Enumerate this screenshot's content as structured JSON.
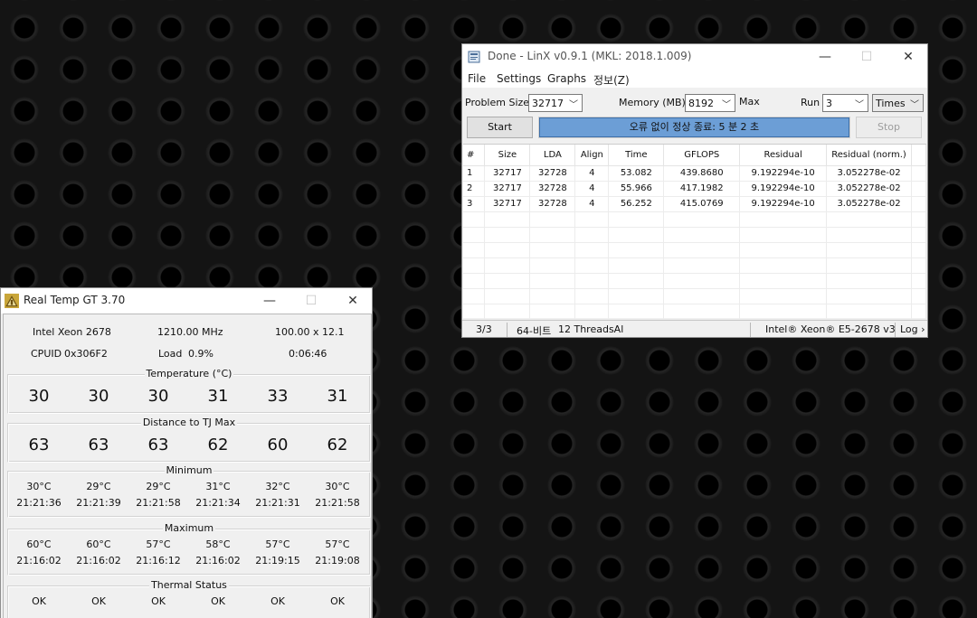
{
  "linx": {
    "title": "Done - LinX v0.9.1 (MKL: 2018.1.009)",
    "icon": "linx-app-icon",
    "window_controls": [
      "—",
      "☐",
      "✕"
    ],
    "menu": [
      "File",
      "Settings",
      "Graphs",
      "정보(Z)"
    ],
    "problem_size_label": "Problem Size:",
    "problem_size_value": "32717",
    "memory_label": "Memory (MB):",
    "memory_value": "8192",
    "max_label": "Max",
    "run_label": "Run",
    "run_value": "3",
    "run_unit": "Times",
    "start_label": "Start",
    "stop_label": "Stop",
    "progress_text": "오류 없이 정상 종료: 5 분 2 초",
    "progress_value": 1.0,
    "columns": [
      "#",
      "Size",
      "LDA",
      "Align",
      "Time",
      "GFLOPS",
      "Residual",
      "Residual (norm.)"
    ],
    "rows": [
      [
        "1",
        "32717",
        "32728",
        "4",
        "53.082",
        "439.8680",
        "9.192294e-10",
        "3.052278e-02"
      ],
      [
        "2",
        "32717",
        "32728",
        "4",
        "55.966",
        "417.1982",
        "9.192294e-10",
        "3.052278e-02"
      ],
      [
        "3",
        "32717",
        "32728",
        "4",
        "56.252",
        "415.0769",
        "9.192294e-10",
        "3.052278e-02"
      ]
    ],
    "status": {
      "count": "3/3",
      "bits": "64-비트",
      "threads": "12 ThreadsAl",
      "cpu": "Intel® Xeon® E5-2678 v3",
      "log": "Log ›"
    }
  },
  "realtemp": {
    "title": "Real Temp GT 3.70",
    "icon": "thermometer-app-icon",
    "window_controls": [
      "—",
      "☐",
      "✕"
    ],
    "cpu_name": "Intel Xeon 2678",
    "frequency": "1210.00 MHz",
    "multiplier": "100.00 x 12.1",
    "cpuid_label": "CPUID",
    "cpuid": "0x306F2",
    "load_label": "Load",
    "load": "0.9%",
    "uptime": "0:06:46",
    "temperature_title": "Temperature (°C)",
    "temperatures": [
      "30",
      "30",
      "30",
      "31",
      "33",
      "31"
    ],
    "distance_title": "Distance to TJ Max",
    "distances": [
      "63",
      "63",
      "63",
      "62",
      "60",
      "62"
    ],
    "minimum_title": "Minimum",
    "min_temps": [
      "30°C",
      "29°C",
      "29°C",
      "31°C",
      "32°C",
      "30°C"
    ],
    "min_times": [
      "21:21:36",
      "21:21:39",
      "21:21:58",
      "21:21:34",
      "21:21:31",
      "21:21:58"
    ],
    "maximum_title": "Maximum",
    "max_temps": [
      "60°C",
      "60°C",
      "57°C",
      "58°C",
      "57°C",
      "57°C"
    ],
    "max_times": [
      "21:16:02",
      "21:16:02",
      "21:16:12",
      "21:16:02",
      "21:19:15",
      "21:19:08"
    ],
    "thermal_title": "Thermal Status",
    "thermal": [
      "OK",
      "OK",
      "OK",
      "OK",
      "OK",
      "OK"
    ]
  }
}
